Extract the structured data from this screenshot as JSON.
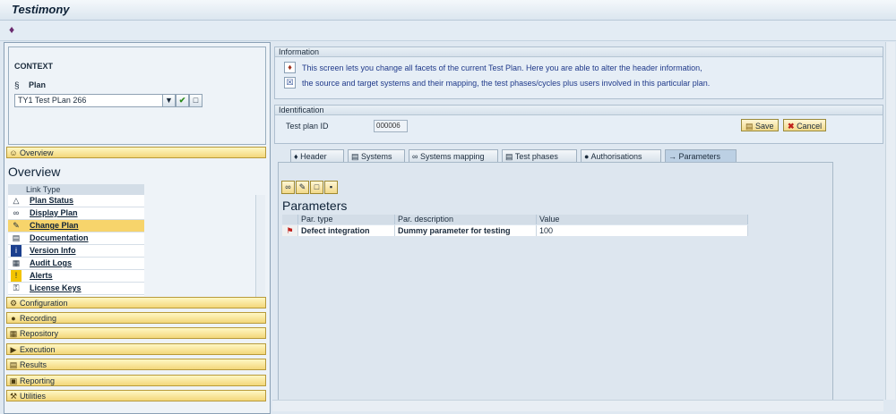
{
  "app": {
    "title": "Testimony"
  },
  "context": {
    "heading": "CONTEXT",
    "plan_label": "Plan",
    "plan_value": "TY1 Test PLan 266"
  },
  "sidebar": {
    "overview_bar": "Overview",
    "overview_heading": "Overview",
    "link_type_header": "Link Type",
    "links": [
      {
        "label": "Plan Status",
        "icon": "status-icon"
      },
      {
        "label": "Display Plan",
        "icon": "glasses-icon"
      },
      {
        "label": "Change Plan",
        "icon": "pencil-icon"
      },
      {
        "label": "Documentation",
        "icon": "doc-icon"
      },
      {
        "label": "Version Info",
        "icon": "info-icon"
      },
      {
        "label": "Audit Logs",
        "icon": "audit-icon"
      },
      {
        "label": "Alerts",
        "icon": "alert-icon"
      },
      {
        "label": "License Keys",
        "icon": "key-icon"
      }
    ],
    "sections": [
      "Configuration",
      "Recording",
      "Repository",
      "Execution",
      "Results",
      "Reporting",
      "Utilities"
    ]
  },
  "information": {
    "title": "Information",
    "line1": "This screen lets you change all facets of the current Test Plan. Here you are able to alter the header information,",
    "line2": "the source and target systems and their mapping, the test phases/cycles plus users involved in this particular plan."
  },
  "identification": {
    "title": "Identification",
    "plan_id_label": "Test plan ID",
    "plan_id_value": "000006",
    "save_label": "Save",
    "cancel_label": "Cancel"
  },
  "tabs": [
    "Header",
    "Systems",
    "Systems mapping",
    "Test phases",
    "Authorisations",
    "Parameters"
  ],
  "active_tab": "Parameters",
  "parameters": {
    "title": "Parameters",
    "columns": [
      "Par. type",
      "Par. description",
      "Value"
    ],
    "rows": [
      {
        "type": "Defect integration",
        "description": "Dummy parameter for testing",
        "value": "100"
      }
    ]
  }
}
